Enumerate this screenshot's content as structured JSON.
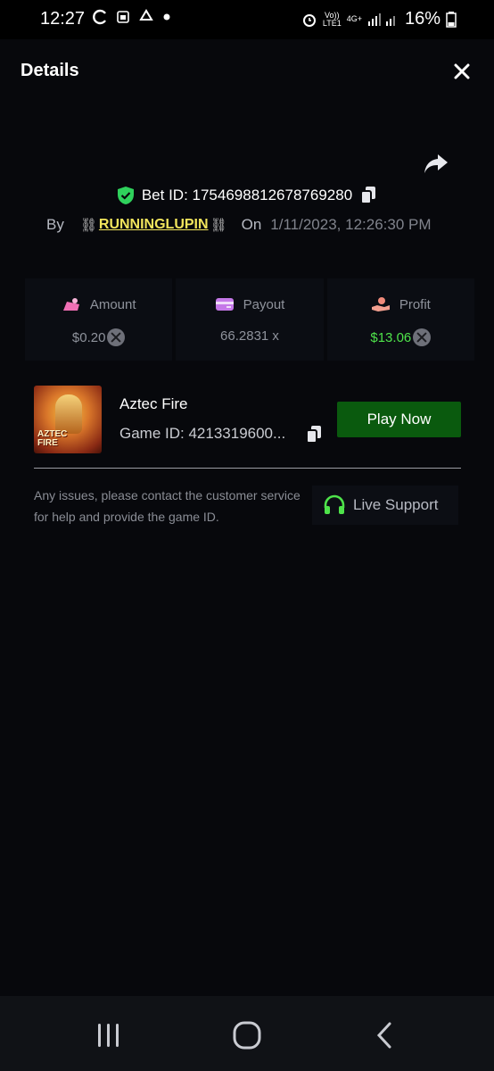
{
  "status_bar": {
    "time": "12:27",
    "battery_percent": "16%",
    "network_top": "Vo))",
    "network_bottom": "LTE1",
    "network_type": "4G+",
    "icons": [
      "sync-icon",
      "screenshot-icon",
      "recycle-icon",
      "dot-icon",
      "alarm-icon",
      "signal-icon",
      "battery-icon"
    ]
  },
  "header": {
    "title": "Details",
    "close_icon": "close-icon"
  },
  "bet": {
    "label": "Bet ID: 1754698812678769280",
    "by_label": "By",
    "chain_left": "⛓",
    "username": "RUNNINGLUPIN",
    "chain_right": "⛓",
    "on_label": "On",
    "date": "1/11/2023, 12:26:30 PM"
  },
  "stats": {
    "amount": {
      "label": "Amount",
      "value": "$0.20"
    },
    "payout": {
      "label": "Payout",
      "value": "66.2831 x"
    },
    "profit": {
      "label": "Profit",
      "value": "$13.06"
    }
  },
  "game": {
    "thumb_text_line1": "AZTEC",
    "thumb_text_line2": "FIRE",
    "name": "Aztec Fire",
    "game_id": "Game ID: 4213319600...",
    "play_label": "Play Now",
    "issue_text": "Any issues, please contact the customer service for help and provide the game ID.",
    "support_label": "Live Support"
  },
  "colors": {
    "background": "#07080c",
    "accent_green": "#0a5a0e",
    "profit_green": "#4ee34a",
    "username_yellow": "#f2e55c",
    "shield_green": "#2fd15c"
  }
}
